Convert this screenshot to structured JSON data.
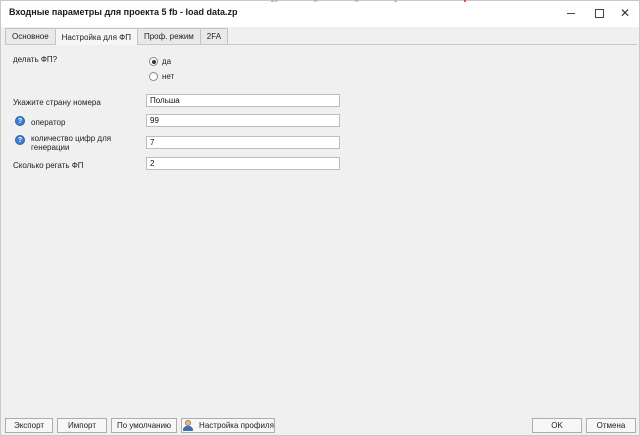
{
  "window": {
    "title": "Входные параметры для проекта 5 fb - load data.zp",
    "ghost_ticks": [
      "20",
      "0",
      "0",
      "1"
    ]
  },
  "tabs": [
    {
      "label": "Основное",
      "active": false
    },
    {
      "label": "Настройка для ФП",
      "active": true
    },
    {
      "label": "Проф. режим",
      "active": false
    },
    {
      "label": "2FA",
      "active": false
    }
  ],
  "form": {
    "make_fp_label": "делать ФП?",
    "options": [
      {
        "label": "да",
        "checked": true
      },
      {
        "label": "нет",
        "checked": false
      }
    ],
    "country_label": "Укажите страну номера",
    "country_value": "Польша",
    "operator_label": "оператор",
    "operator_value": "99",
    "digits_label": "количество цифр для генерации",
    "digits_value": "7",
    "reg_count_label": "Сколько регать ФП",
    "reg_count_value": "2"
  },
  "footer": {
    "export_label": "Экспорт",
    "import_label": "Импорт",
    "default_label": "По умолчанию",
    "profile_label": "Настройка профиля",
    "ok_label": "OK",
    "cancel_label": "Отмена"
  },
  "icons": {
    "help": "?",
    "close": "✕"
  },
  "colors": {
    "help_icon": "#3f7fd0",
    "tick_accent": "#e0522f"
  }
}
